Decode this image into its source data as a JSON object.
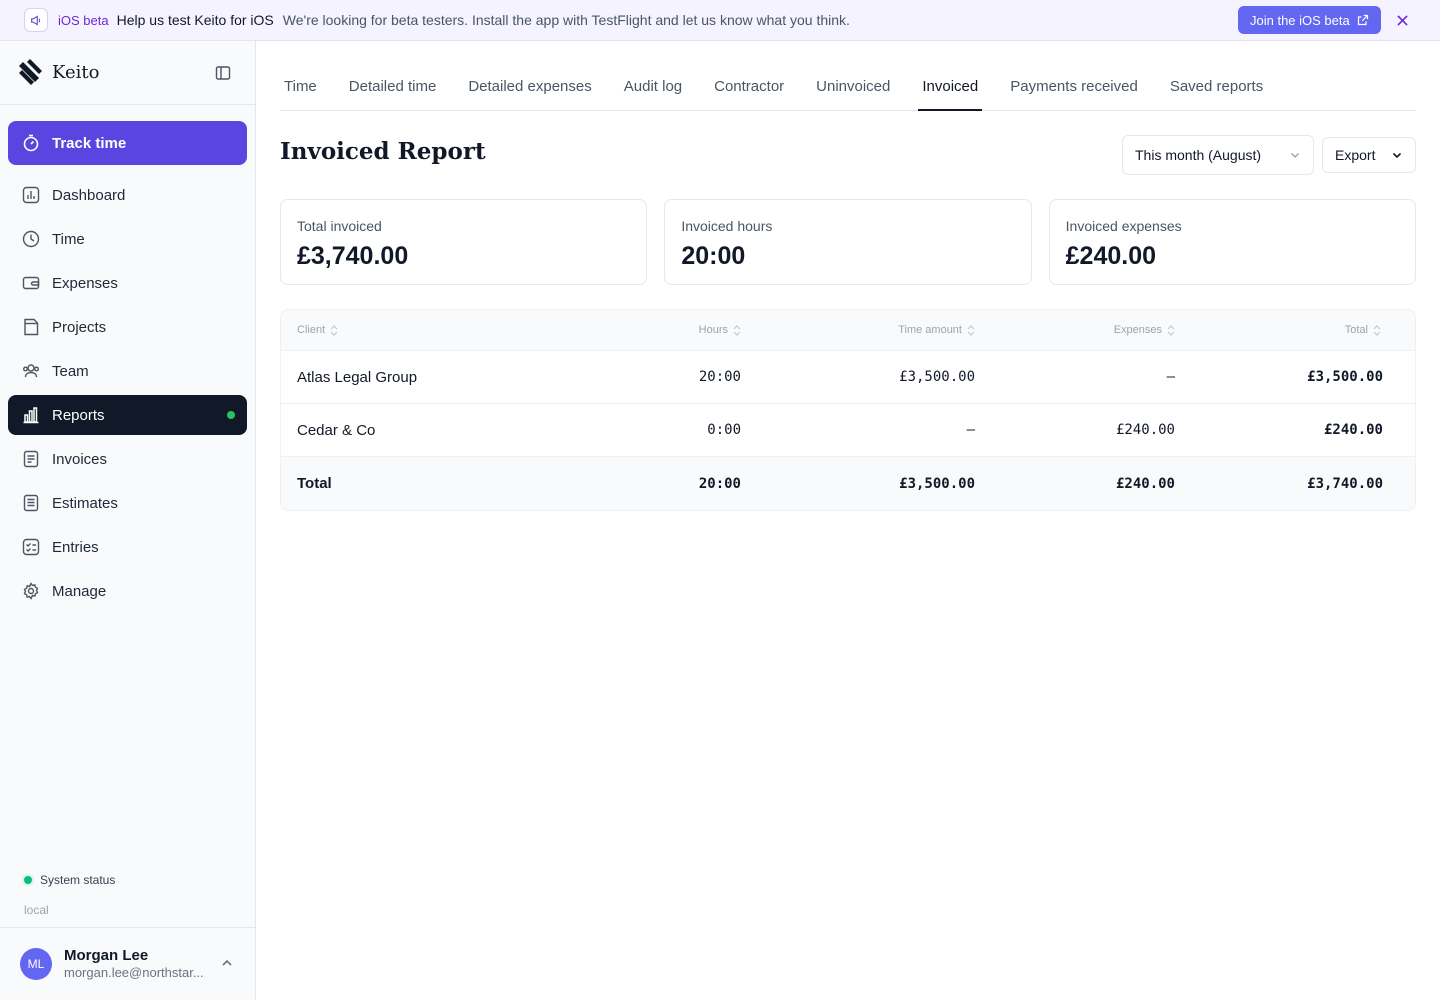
{
  "banner": {
    "tag": "iOS beta",
    "title": "Help us test Keito for iOS",
    "text": "We're looking for beta testers. Install the app with TestFlight and let us know what you think.",
    "cta": "Join the iOS beta",
    "icon": "megaphone-icon"
  },
  "sidebar": {
    "brand": "Keito",
    "track_time": "Track time",
    "items": [
      {
        "label": "Dashboard",
        "icon": "chart-icon"
      },
      {
        "label": "Time",
        "icon": "clock-icon"
      },
      {
        "label": "Expenses",
        "icon": "wallet-icon"
      },
      {
        "label": "Projects",
        "icon": "folder-icon"
      },
      {
        "label": "Team",
        "icon": "users-icon"
      },
      {
        "label": "Reports",
        "icon": "bar-chart-icon",
        "active": true
      },
      {
        "label": "Invoices",
        "icon": "invoice-icon"
      },
      {
        "label": "Estimates",
        "icon": "list-icon"
      },
      {
        "label": "Entries",
        "icon": "checklist-icon"
      },
      {
        "label": "Manage",
        "icon": "gear-icon"
      }
    ],
    "system_status": "System status",
    "environment": "local",
    "user": {
      "initials": "ML",
      "name": "Morgan Lee",
      "email": "morgan.lee@northstar..."
    }
  },
  "tabs": [
    "Time",
    "Detailed time",
    "Detailed expenses",
    "Audit log",
    "Contractor",
    "Uninvoiced",
    "Invoiced",
    "Payments received",
    "Saved reports"
  ],
  "active_tab": "Invoiced",
  "page": {
    "title": "Invoiced Report",
    "period": "This month (August)",
    "export": "Export"
  },
  "summary": {
    "total_invoiced_label": "Total invoiced",
    "total_invoiced_value": "£3,740.00",
    "invoiced_hours_label": "Invoiced hours",
    "invoiced_hours_value": "20:00",
    "invoiced_expenses_label": "Invoiced expenses",
    "invoiced_expenses_value": "£240.00"
  },
  "table": {
    "headers": [
      "Client",
      "Hours",
      "Time amount",
      "Expenses",
      "Total"
    ],
    "rows": [
      {
        "client": "Atlas Legal Group",
        "hours": "20:00",
        "time_amount": "£3,500.00",
        "expenses": "—",
        "total": "£3,500.00"
      },
      {
        "client": "Cedar & Co",
        "hours": "0:00",
        "time_amount": "—",
        "expenses": "£240.00",
        "total": "£240.00"
      }
    ],
    "footer": {
      "client": "Total",
      "hours": "20:00",
      "time_amount": "£3,500.00",
      "expenses": "£240.00",
      "total": "£3,740.00"
    }
  },
  "colors": {
    "accent": "#5b45e0",
    "banner_cta": "#6366f1",
    "active_nav": "#111827",
    "status_dot": "#22c55e"
  }
}
